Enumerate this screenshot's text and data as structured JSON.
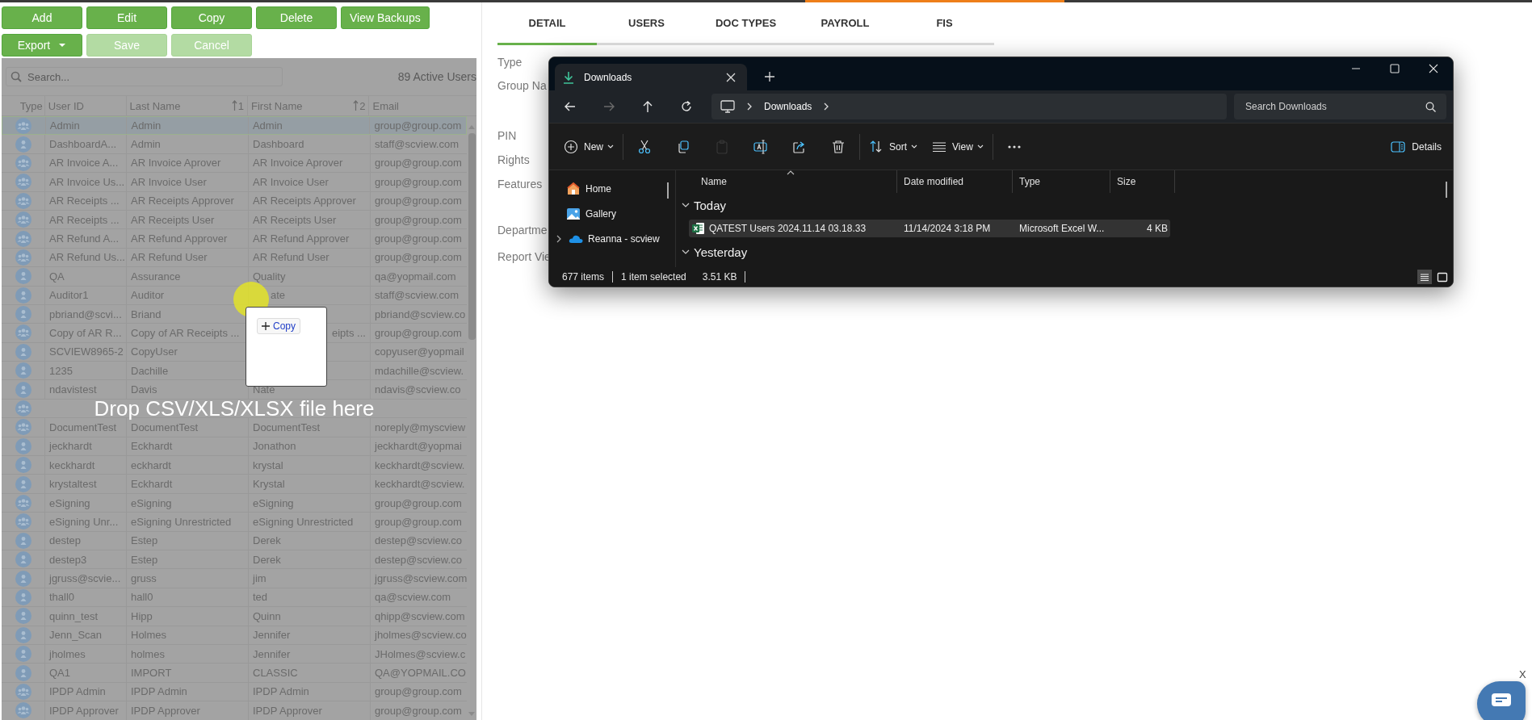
{
  "toolbar": {
    "button_rows": [
      [
        {
          "label": "Add",
          "disabled": false,
          "menu": false
        },
        {
          "label": "Edit",
          "disabled": false,
          "menu": false
        },
        {
          "label": "Copy",
          "disabled": false,
          "menu": false
        },
        {
          "label": "Delete",
          "disabled": false,
          "menu": false
        },
        {
          "label": "View Backups",
          "disabled": false,
          "menu": false
        }
      ],
      [
        {
          "label": "Export",
          "disabled": false,
          "menu": true
        },
        {
          "label": "Save",
          "disabled": true,
          "menu": false
        },
        {
          "label": "Cancel",
          "disabled": true,
          "menu": false
        }
      ]
    ]
  },
  "user_grid": {
    "search": {
      "placeholder": "Search..."
    },
    "count": "89 Active Users",
    "columns": [
      {
        "label": "Type"
      },
      {
        "label": "User ID"
      },
      {
        "label": "Last Name",
        "sort": "1"
      },
      {
        "label": "First Name",
        "sort": "2"
      },
      {
        "label": "Email"
      }
    ],
    "rows": [
      {
        "kind": "group",
        "user_id": "Admin",
        "last_name": "Admin",
        "first_name": "Admin",
        "email": "group@group.com",
        "selected": true
      },
      {
        "kind": "user",
        "user_id": "DashboardA...",
        "last_name": "Admin",
        "first_name": "Dashboard",
        "email": "staff@scview.com",
        "selected": false
      },
      {
        "kind": "group",
        "user_id": "AR Invoice A...",
        "last_name": "AR Invoice Aprover",
        "first_name": "AR Invoice Aprover",
        "email": "group@group.com",
        "selected": false
      },
      {
        "kind": "group",
        "user_id": "AR Invoice Us...",
        "last_name": "AR Invoice User",
        "first_name": "AR Invoice User",
        "email": "group@group.com",
        "selected": false
      },
      {
        "kind": "group",
        "user_id": "AR Receipts ...",
        "last_name": "AR Receipts Approver",
        "first_name": "AR Receipts Approver",
        "email": "group@group.com",
        "selected": false
      },
      {
        "kind": "group",
        "user_id": "AR Receipts ...",
        "last_name": "AR Receipts User",
        "first_name": "AR Receipts User",
        "email": "group@group.com",
        "selected": false
      },
      {
        "kind": "group",
        "user_id": "AR Refund A...",
        "last_name": "AR Refund Approver",
        "first_name": "AR Refund Approver",
        "email": "group@group.com",
        "selected": false
      },
      {
        "kind": "group",
        "user_id": "AR Refund Us...",
        "last_name": "AR Refund User",
        "first_name": "AR Refund User",
        "email": "group@group.com",
        "selected": false
      },
      {
        "kind": "user",
        "user_id": "QA",
        "last_name": "Assurance",
        "first_name": "Quality",
        "email": "qa@yopmail.com",
        "selected": false
      },
      {
        "kind": "user",
        "user_id": "Auditor1",
        "last_name": "Auditor",
        "first_name_tail": "ate",
        "email": "staff@scview.com",
        "selected": false
      },
      {
        "kind": "user",
        "user_id": "pbriand@scvi...",
        "last_name": "Briand",
        "email": "pbriand@scview.co",
        "selected": false
      },
      {
        "kind": "group",
        "user_id": "Copy of AR R...",
        "last_name": "Copy of AR Receipts ...",
        "first_name_tail": "eipts ...",
        "email": "group@group.com",
        "selected": false
      },
      {
        "kind": "user",
        "user_id": "SCVIEW8965-2",
        "last_name": "CopyUser",
        "email": "copyuser@yopmail",
        "selected": false
      },
      {
        "kind": "user",
        "user_id": "1235",
        "last_name": "Dachille",
        "email": "mdachille@scview.",
        "selected": false
      },
      {
        "kind": "user",
        "user_id": "ndavistest",
        "last_name": "Davis",
        "first_name": "Nate",
        "email": "ndavis@scview.co",
        "selected": false
      },
      {
        "kind": "group",
        "selected": false
      },
      {
        "kind": "group",
        "user_id": "DocumentTest",
        "last_name": "DocumentTest",
        "first_name": "DocumentTest",
        "email": "noreply@myscview",
        "selected": false
      },
      {
        "kind": "user",
        "user_id": "jeckhardt",
        "last_name": "Eckhardt",
        "first_name": "Jonathon",
        "email": "jeckhardt@yopmai",
        "selected": false
      },
      {
        "kind": "user",
        "user_id": "keckhardt",
        "last_name": "eckhardt",
        "first_name": "krystal",
        "email": "keckhardt@scview.",
        "selected": false
      },
      {
        "kind": "user",
        "user_id": "krystaltest",
        "last_name": "Eckhardt",
        "first_name": "Krystal",
        "email": "keckhardt@scview.",
        "selected": false
      },
      {
        "kind": "group",
        "user_id": "eSigning",
        "last_name": "eSigning",
        "first_name": "eSigning",
        "email": "group@group.com",
        "selected": false
      },
      {
        "kind": "group",
        "user_id": "eSigning Unr...",
        "last_name": "eSigning Unrestricted",
        "first_name": "eSigning Unrestricted",
        "email": "group@group.com",
        "selected": false
      },
      {
        "kind": "user",
        "user_id": "destep",
        "last_name": "Estep",
        "first_name": "Derek",
        "email": "destep@scview.co",
        "selected": false
      },
      {
        "kind": "user",
        "user_id": "destep3",
        "last_name": "Estep",
        "first_name": "Derek",
        "email": "destep@scview.co",
        "selected": false
      },
      {
        "kind": "user",
        "user_id": "jgruss@scvie...",
        "last_name": "gruss",
        "first_name": "jim",
        "email": "jgruss@scview.com",
        "selected": false
      },
      {
        "kind": "user",
        "user_id": "thall0",
        "last_name": "hall0",
        "first_name": "ted",
        "email": "qa@scview.com",
        "selected": false
      },
      {
        "kind": "user",
        "user_id": "quinn_test",
        "last_name": "Hipp",
        "first_name": "Quinn",
        "email": "qhipp@scview.com",
        "selected": false
      },
      {
        "kind": "user",
        "user_id": "Jenn_Scan",
        "last_name": "Holmes",
        "first_name": "Jennifer",
        "email": "jholmes@scview.co",
        "selected": false
      },
      {
        "kind": "user",
        "user_id": "jholmes",
        "last_name": "holmes",
        "first_name": "Jennifer",
        "email": "JHolmes@scview.c",
        "selected": false
      },
      {
        "kind": "user",
        "user_id": "QA1",
        "last_name": "IMPORT",
        "first_name": "CLASSIC",
        "email": "QA@YOPMAIL.CO",
        "selected": false
      },
      {
        "kind": "group",
        "user_id": "IPDP Admin",
        "last_name": "IPDP Admin",
        "first_name": "IPDP Admin",
        "email": "group@group.com",
        "selected": false
      },
      {
        "kind": "group",
        "user_id": "IPDP Approver",
        "last_name": "IPDP Approver",
        "first_name": "IPDP Approver",
        "email": "group@group.com",
        "selected": false
      }
    ]
  },
  "drop_zone": {
    "message": "Drop CSV/XLS/XLSX file here",
    "drag_card": {
      "action": "Copy"
    }
  },
  "detail": {
    "tabs": [
      {
        "label": "DETAIL",
        "selected": true
      },
      {
        "label": "USERS",
        "selected": false
      },
      {
        "label": "DOC TYPES",
        "selected": false
      },
      {
        "label": "PAYROLL",
        "selected": false
      },
      {
        "label": "FIS",
        "selected": false
      }
    ],
    "field_labels": [
      "Type",
      "Group Na",
      "PIN",
      "Rights",
      "Features",
      "Departme",
      "Report Vie"
    ]
  },
  "file_explorer": {
    "tabs": [
      {
        "title": "Downloads",
        "selected": true
      }
    ],
    "nav_buttons": [
      {
        "kind": "back",
        "disabled": false
      },
      {
        "kind": "forward",
        "disabled": true
      },
      {
        "kind": "up",
        "disabled": false
      },
      {
        "kind": "refresh",
        "disabled": false
      }
    ],
    "address": [
      "Downloads"
    ],
    "search": {
      "placeholder": "Search Downloads"
    },
    "commands": [
      {
        "kind": "new",
        "label": "New",
        "menu": true,
        "disabled": false
      },
      {
        "kind": "separator"
      },
      {
        "kind": "cut",
        "disabled": false
      },
      {
        "kind": "copy",
        "disabled": false
      },
      {
        "kind": "paste",
        "disabled": true
      },
      {
        "kind": "rename",
        "disabled": false
      },
      {
        "kind": "share",
        "disabled": false
      },
      {
        "kind": "delete",
        "disabled": false
      },
      {
        "kind": "separator"
      },
      {
        "kind": "sort",
        "label": "Sort",
        "menu": true,
        "disabled": false
      },
      {
        "kind": "view",
        "label": "View",
        "menu": true,
        "disabled": false
      },
      {
        "kind": "separator"
      },
      {
        "kind": "more",
        "disabled": false
      }
    ],
    "details_button": "Details",
    "nav_pane": [
      {
        "kind": "home",
        "label": "Home",
        "expandable": false
      },
      {
        "kind": "gallery",
        "label": "Gallery",
        "expandable": false
      },
      {
        "kind": "cloud",
        "label": "Reanna - scview",
        "expandable": true
      }
    ],
    "columns": [
      {
        "label": "Name",
        "sorted": true
      },
      {
        "label": "Date modified",
        "sorted": false
      },
      {
        "label": "Type",
        "sorted": false
      },
      {
        "label": "Size",
        "sorted": false
      }
    ],
    "groups": [
      {
        "label": "Today",
        "expanded": true,
        "files": [
          {
            "name": "QATEST Users 2024.11.14 03.18.33",
            "date": "11/14/2024 3:18 PM",
            "type": "Microsoft Excel W...",
            "size": "4 KB",
            "selected": true
          }
        ]
      },
      {
        "label": "Yesterday",
        "expanded": true
      }
    ],
    "status": {
      "items": "677 items",
      "selection": "1 item selected",
      "size": "3.51 KB"
    },
    "view_modes": [
      {
        "kind": "details",
        "selected": true
      },
      {
        "kind": "tiles",
        "selected": false
      }
    ]
  },
  "chat_widget": {
    "close_label": "X"
  }
}
